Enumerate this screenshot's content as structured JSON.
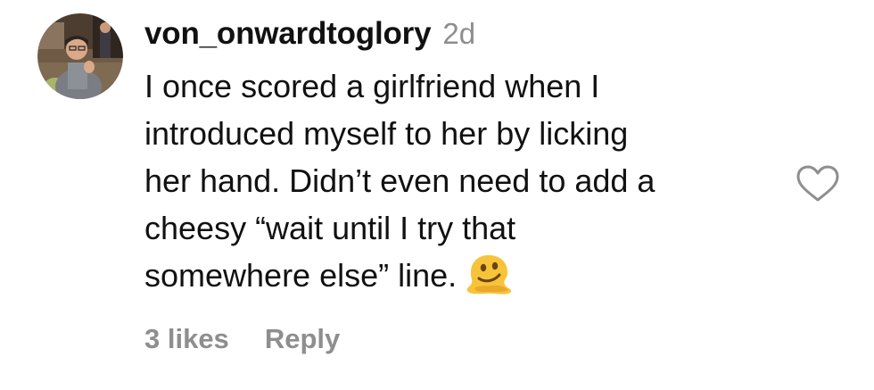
{
  "comment": {
    "username": "von_onwardtoglory",
    "time_ago": "2d",
    "text_lines": [
      "I once scored a girlfriend when I",
      "introduced myself to her by licking",
      "her hand. Didn’t even need to add a",
      "cheesy “wait until I try that",
      "somewhere else” line."
    ],
    "emoji": "melting-face-emoji",
    "likes_label": "3 likes",
    "reply_label": "Reply",
    "like_icon": "heart-outline-icon"
  },
  "colors": {
    "text": "#111111",
    "muted": "#8e8e8e",
    "background": "#ffffff"
  }
}
